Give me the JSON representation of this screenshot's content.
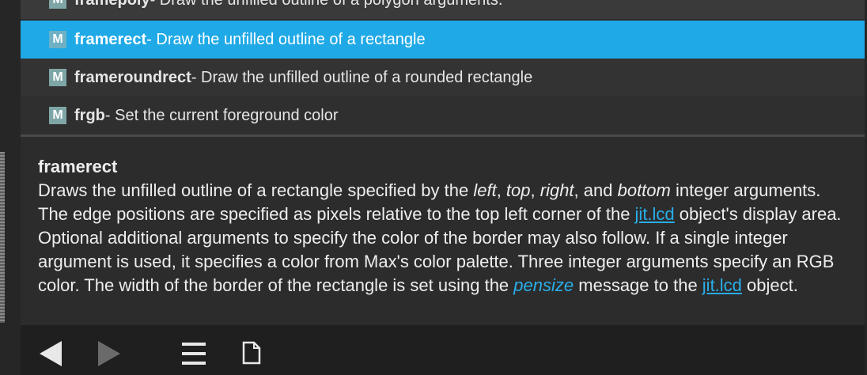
{
  "list": {
    "items": [
      {
        "badge": "M",
        "name": "framepoly",
        "desc": " - Draw the unfilled outline of a polygon arguments."
      },
      {
        "badge": "M",
        "name": "framerect",
        "desc": " - Draw the unfilled outline of a rectangle"
      },
      {
        "badge": "M",
        "name": "frameroundrect",
        "desc": " - Draw the unfilled outline of a rounded rectangle"
      },
      {
        "badge": "M",
        "name": "frgb",
        "desc": " - Set the current foreground color"
      }
    ],
    "selected_index": 1
  },
  "detail": {
    "title": "framerect",
    "p1": "Draws the unfilled outline of a rectangle specified by the ",
    "w_left": "left",
    "c1": ", ",
    "w_top": "top",
    "c2": ", ",
    "w_right": "right",
    "c3": ", and ",
    "w_bottom": "bottom",
    "p2": " integer arguments. The edge positions are specified as pixels relative to the top left corner of the ",
    "link1": "jit.lcd",
    "p3": " object's display area. Optional additional arguments to specify the color of the border may also follow. If a single integer argument is used, it specifies a color from Max's color palette. Three integer arguments specify an RGB color. The width of the border of the rectangle is set using the ",
    "link_pensize": "pensize",
    "p4": " message to the ",
    "link2": "jit.lcd",
    "p5": " object."
  },
  "footer": {
    "back_icon": "triangle-left",
    "forward_icon": "triangle-right",
    "menu_icon": "hamburger",
    "doc_icon": "document"
  },
  "colors": {
    "selection": "#1fa9e6",
    "link": "#29aee9",
    "badge": "#7fa6a6"
  }
}
